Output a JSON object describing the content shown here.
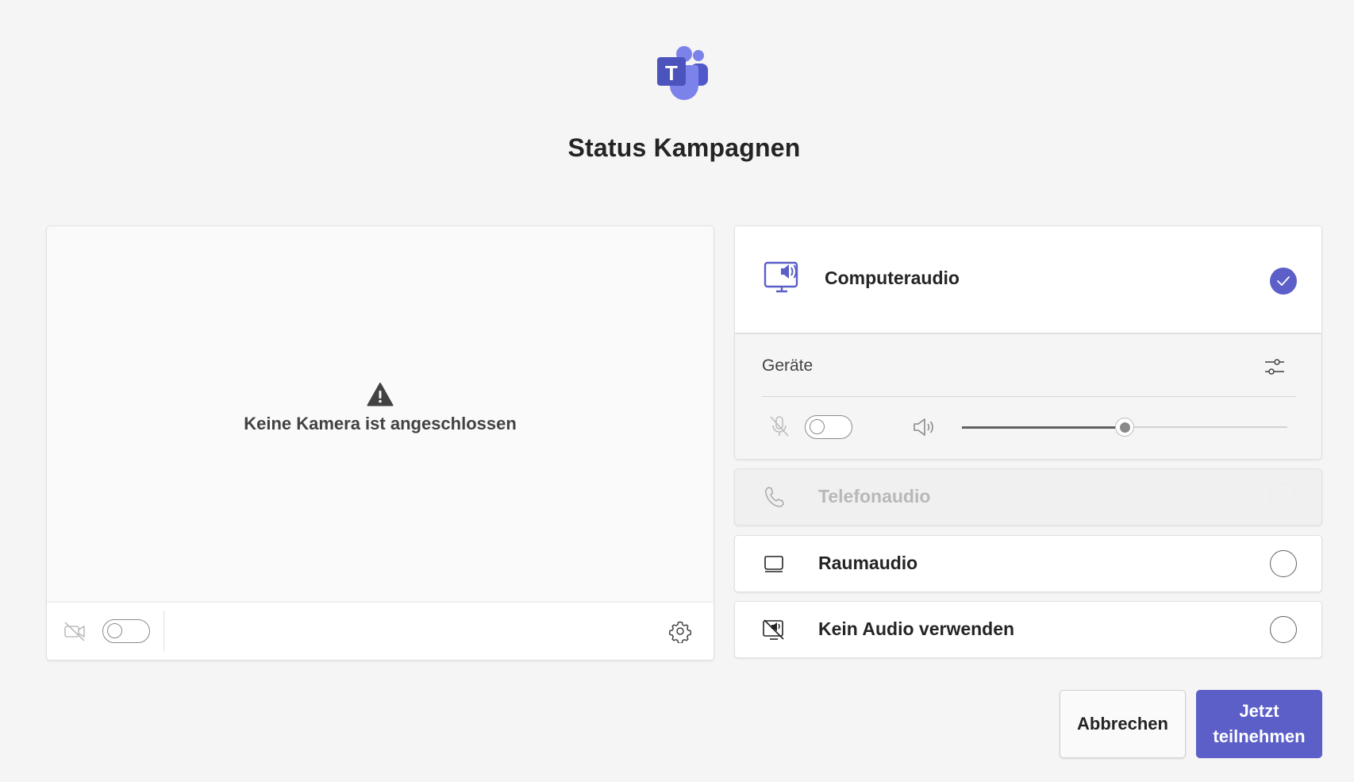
{
  "meeting": {
    "title": "Status Kampagnen"
  },
  "camera": {
    "message": "Keine Kamera ist angeschlossen",
    "toggle_on": false
  },
  "audio": {
    "options": [
      {
        "label": "Computeraudio",
        "icon": "computer-speaker-icon",
        "selected": true
      },
      {
        "label": "Telefonaudio",
        "icon": "phone-icon",
        "selected": false,
        "disabled": true
      },
      {
        "label": "Raumaudio",
        "icon": "room-device-icon",
        "selected": false
      },
      {
        "label": "Kein Audio verwenden",
        "icon": "no-audio-icon",
        "selected": false
      }
    ],
    "devices_label": "Geräte",
    "mic_on": false,
    "volume": 0.5
  },
  "buttons": {
    "cancel": "Abbrechen",
    "join": "Jetzt teilnehmen"
  },
  "colors": {
    "accent": "#5b5fc7",
    "background": "#f5f5f5"
  }
}
